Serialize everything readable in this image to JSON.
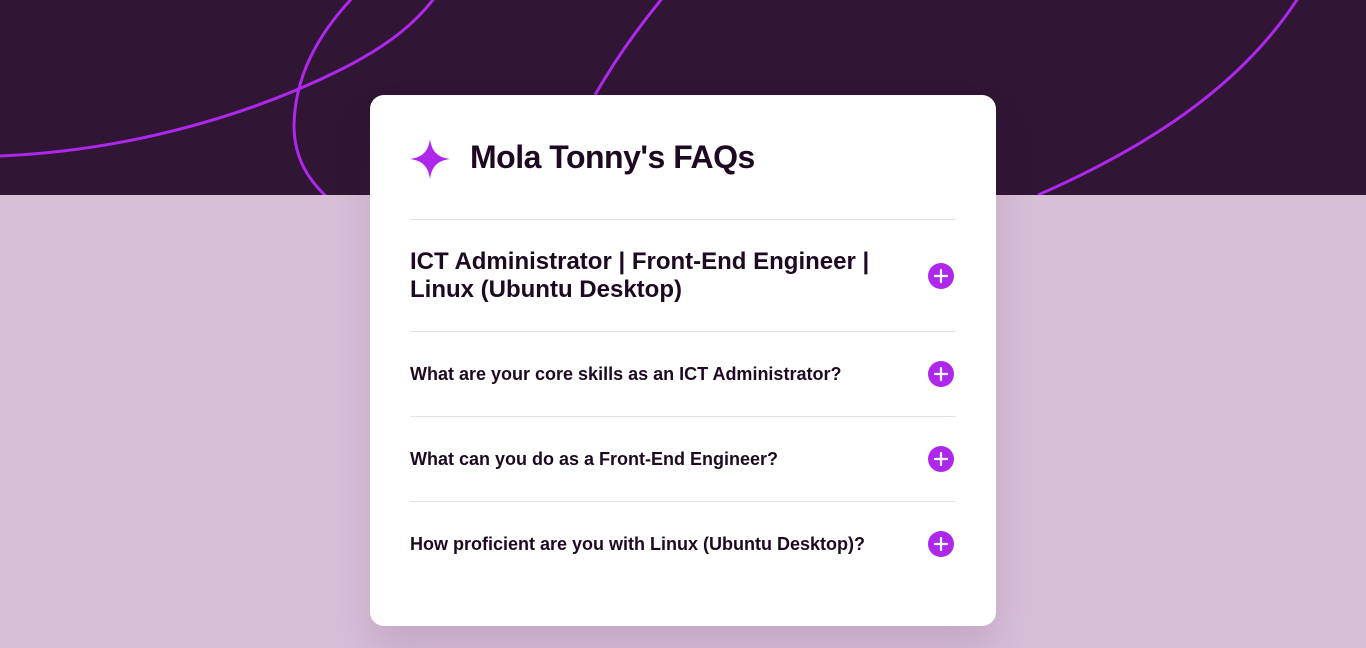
{
  "page": {
    "title": "Mola Tonny's FAQs",
    "colors": {
      "hero_background": "#301534",
      "page_background": "#d8bfd8",
      "accent": "#ad28eb",
      "text": "#1d0a22",
      "card": "#ffffff"
    }
  },
  "faqs": [
    {
      "question": "ICT Administrator | Front-End Engineer | Linux (Ubuntu Desktop)",
      "icon": "plus-icon",
      "expanded": false
    },
    {
      "question": "What are your core skills as an ICT Administrator?",
      "icon": "plus-icon",
      "expanded": false
    },
    {
      "question": "What can you do as a Front-End Engineer?",
      "icon": "plus-icon",
      "expanded": false
    },
    {
      "question": "How proficient are you with Linux (Ubuntu Desktop)?",
      "icon": "plus-icon",
      "expanded": false
    }
  ],
  "icons": {
    "header_icon": "star-icon",
    "toggle_icon": "plus-icon"
  }
}
